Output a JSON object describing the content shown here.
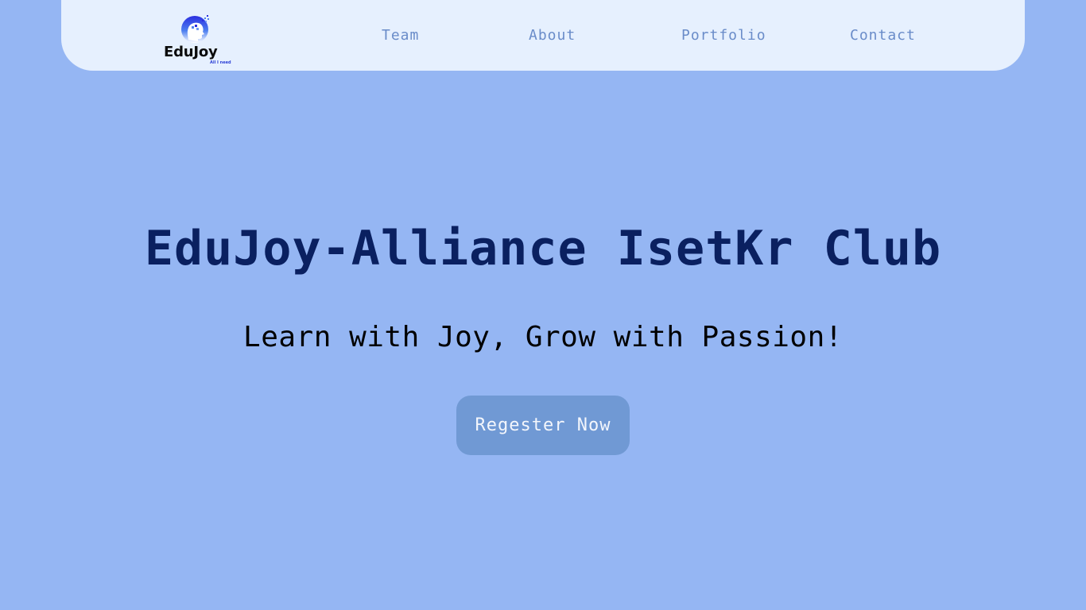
{
  "brand": {
    "name": "EduJoy",
    "tagline": "All I need",
    "logo_icon": "head-pixel-icon",
    "colors": {
      "gradient_top": "#2b2fe0",
      "gradient_bottom": "#ffffff"
    }
  },
  "nav": {
    "items": [
      {
        "label": "Team"
      },
      {
        "label": "About"
      },
      {
        "label": "Portfolio"
      },
      {
        "label": "Contact"
      }
    ]
  },
  "hero": {
    "title": "EduJoy-Alliance IsetKr Club",
    "subtitle": "Learn with Joy, Grow with Passion!",
    "cta_label": "Regester Now"
  },
  "colors": {
    "page_background": "#95b6f3",
    "navbar_background": "#e6f0fe",
    "nav_link": "#6a8cc9",
    "title": "#0a2060",
    "button_background": "#7099d4",
    "button_text": "#f3f6fc"
  }
}
